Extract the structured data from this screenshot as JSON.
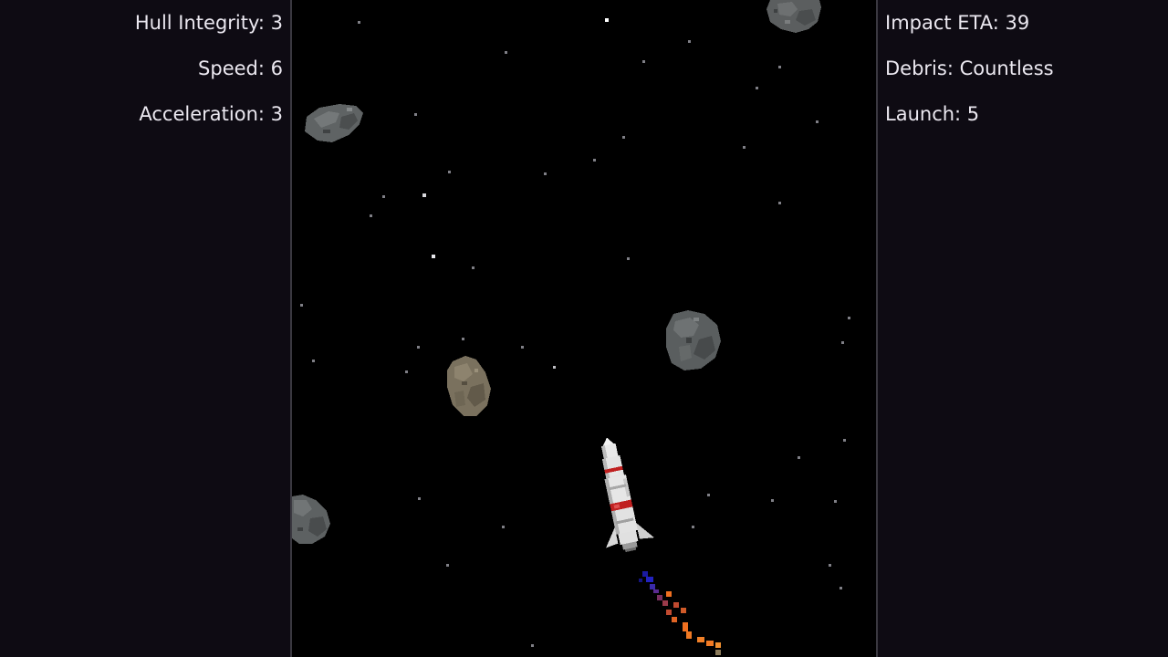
{
  "hud": {
    "left": {
      "hull_integrity": "Hull Integrity: 3",
      "speed": "Speed: 6",
      "acceleration": "Acceleration: 3"
    },
    "right": {
      "impact_eta": "Impact ETA: 39",
      "debris": "Debris: Countless",
      "launch": "Launch: 5"
    }
  },
  "colors": {
    "background": "#000000",
    "panel": "#0e0b13",
    "hud_text": "#ebe8f0",
    "asteroid_grey": "#5f6364",
    "asteroid_brown": "#7a715e",
    "rocket_body": "#e6e6e6",
    "rocket_accent": "#c02020",
    "exhaust_orange": "#f07020",
    "exhaust_blue": "#1a1aa0"
  },
  "sprites": {
    "player": "rocket-icon",
    "obstacles": [
      "asteroid-icon",
      "asteroid-icon",
      "asteroid-icon",
      "asteroid-icon",
      "asteroid-icon"
    ],
    "trail": "exhaust-trail-icon"
  }
}
